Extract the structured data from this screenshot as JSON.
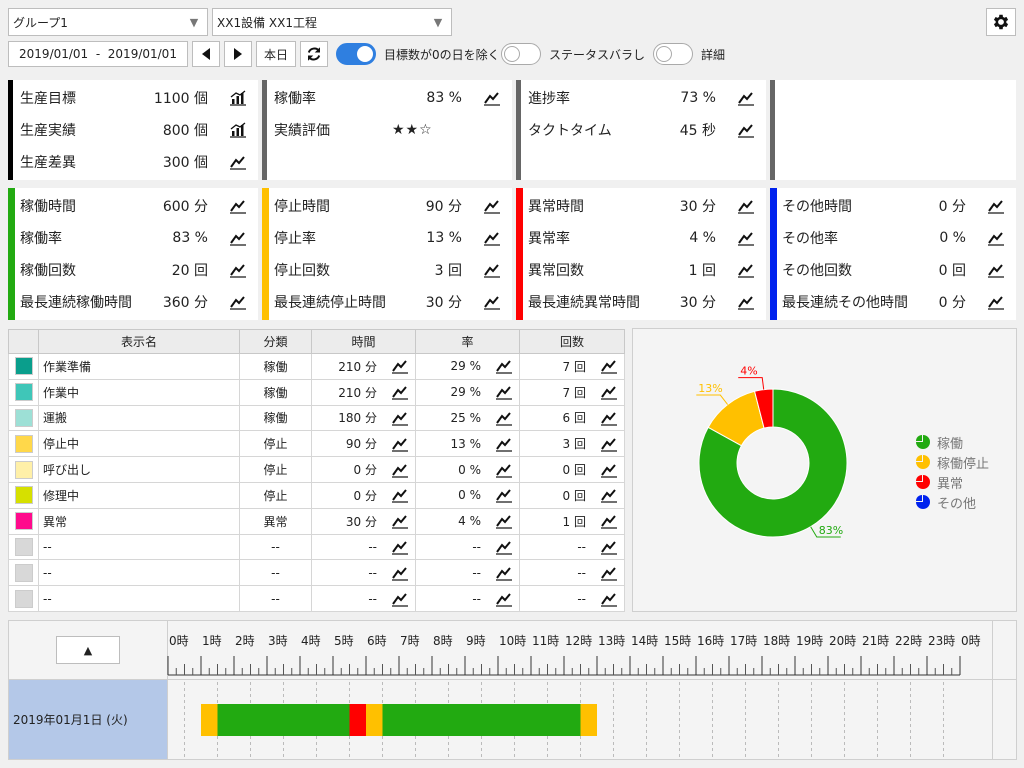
{
  "header": {
    "group_select": "グループ1",
    "equipment_select": "XX1設備 XX1工程",
    "date_range": "2019/01/01  -  2019/01/01",
    "today_label": "本日",
    "toggles": [
      {
        "label": "目標数が0の日を除く",
        "on": true
      },
      {
        "label": "ステータスバラし",
        "on": false
      },
      {
        "label": "詳細",
        "on": false
      }
    ]
  },
  "summary": [
    {
      "color": "#000000",
      "rows": [
        {
          "label": "生産目標",
          "value": "1100 個",
          "icon": "bar-chart-icon"
        },
        {
          "label": "生産実績",
          "value": "800 個",
          "icon": "bar-chart-icon"
        },
        {
          "label": "生産差異",
          "value": "300 個",
          "icon": "line-chart-icon"
        }
      ]
    },
    {
      "color": "#666666",
      "rows": [
        {
          "label": "稼働率",
          "value": "83 %",
          "icon": "line-chart-icon"
        },
        {
          "label": "実績評価",
          "stars": "★★☆"
        }
      ]
    },
    {
      "color": "#666666",
      "rows": [
        {
          "label": "進捗率",
          "value": "73 %",
          "icon": "line-chart-icon"
        },
        {
          "label": "タクトタイム",
          "value": "45 秒",
          "icon": "line-chart-icon"
        }
      ]
    },
    {
      "color": "#666666",
      "rows": []
    }
  ],
  "status_panels": [
    {
      "color": "#22aa11",
      "rows": [
        {
          "label": "稼働時間",
          "value": "600 分"
        },
        {
          "label": "稼働率",
          "value": "83 %"
        },
        {
          "label": "稼働回数",
          "value": "20 回"
        },
        {
          "label": "最長連続稼働時間",
          "value": "360 分"
        }
      ]
    },
    {
      "color": "#ffc000",
      "rows": [
        {
          "label": "停止時間",
          "value": "90 分"
        },
        {
          "label": "停止率",
          "value": "13 %"
        },
        {
          "label": "停止回数",
          "value": "3 回"
        },
        {
          "label": "最長連続停止時間",
          "value": "30 分"
        }
      ]
    },
    {
      "color": "#ff0000",
      "rows": [
        {
          "label": "異常時間",
          "value": "30 分"
        },
        {
          "label": "異常率",
          "value": "4 %"
        },
        {
          "label": "異常回数",
          "value": "1 回"
        },
        {
          "label": "最長連続異常時間",
          "value": "30 分"
        }
      ]
    },
    {
      "color": "#0022ee",
      "rows": [
        {
          "label": "その他時間",
          "value": "0 分"
        },
        {
          "label": "その他率",
          "value": "0 %"
        },
        {
          "label": "その他回数",
          "value": "0 回"
        },
        {
          "label": "最長連続その他時間",
          "value": "0 分"
        }
      ]
    }
  ],
  "table": {
    "headers": [
      "",
      "表示名",
      "分類",
      "時間",
      "率",
      "回数"
    ],
    "rows": [
      {
        "color": "#0a9e8c",
        "name": "作業準備",
        "cat": "稼働",
        "time": "210 分",
        "rate": "29 %",
        "count": "7 回"
      },
      {
        "color": "#3fc6b8",
        "name": "作業中",
        "cat": "稼働",
        "time": "210 分",
        "rate": "29 %",
        "count": "7 回"
      },
      {
        "color": "#9de0d6",
        "name": "運搬",
        "cat": "稼働",
        "time": "180 分",
        "rate": "25 %",
        "count": "6 回"
      },
      {
        "color": "#ffd84a",
        "name": "停止中",
        "cat": "停止",
        "time": "90 分",
        "rate": "13 %",
        "count": "3 回"
      },
      {
        "color": "#fff0a8",
        "name": "呼び出し",
        "cat": "停止",
        "time": "0 分",
        "rate": "0 %",
        "count": "0 回"
      },
      {
        "color": "#d6e000",
        "name": "修理中",
        "cat": "停止",
        "time": "0 分",
        "rate": "0 %",
        "count": "0 回"
      },
      {
        "color": "#ff0a8c",
        "name": "異常",
        "cat": "異常",
        "time": "30 分",
        "rate": "4 %",
        "count": "1 回"
      },
      {
        "color": "#d8d8d8",
        "name": "--",
        "cat": "--",
        "time": "--",
        "rate": "--",
        "count": "--"
      },
      {
        "color": "#d8d8d8",
        "name": "--",
        "cat": "--",
        "time": "--",
        "rate": "--",
        "count": "--"
      },
      {
        "color": "#d8d8d8",
        "name": "--",
        "cat": "--",
        "time": "--",
        "rate": "--",
        "count": "--"
      }
    ]
  },
  "donut": {
    "segments": [
      {
        "name": "稼働",
        "value": 83,
        "label": "83%",
        "color": "#22aa11"
      },
      {
        "name": "稼働停止",
        "value": 13,
        "label": "13%",
        "color": "#ffc000"
      },
      {
        "name": "異常",
        "value": 4,
        "label": "4%",
        "color": "#ff0000"
      },
      {
        "name": "その他",
        "value": 0,
        "label": "",
        "color": "#0022ee"
      }
    ]
  },
  "timeline": {
    "collapse_label": "▲",
    "hours": [
      "0時",
      "1時",
      "2時",
      "3時",
      "4時",
      "5時",
      "6時",
      "7時",
      "8時",
      "9時",
      "10時",
      "11時",
      "12時",
      "13時",
      "14時",
      "15時",
      "16時",
      "17時",
      "18時",
      "19時",
      "20時",
      "21時",
      "22時",
      "23時",
      "0時"
    ],
    "row_label": "2019年01月1日 (火)",
    "blocks": [
      {
        "start_hour": 1.0,
        "end_hour": 1.5,
        "color": "#ffc000"
      },
      {
        "start_hour": 1.5,
        "end_hour": 5.5,
        "color": "#22aa11"
      },
      {
        "start_hour": 5.5,
        "end_hour": 6.0,
        "color": "#ff0000"
      },
      {
        "start_hour": 6.0,
        "end_hour": 6.5,
        "color": "#ffc000"
      },
      {
        "start_hour": 6.5,
        "end_hour": 12.5,
        "color": "#22aa11"
      },
      {
        "start_hour": 12.5,
        "end_hour": 13.0,
        "color": "#ffc000"
      }
    ]
  }
}
